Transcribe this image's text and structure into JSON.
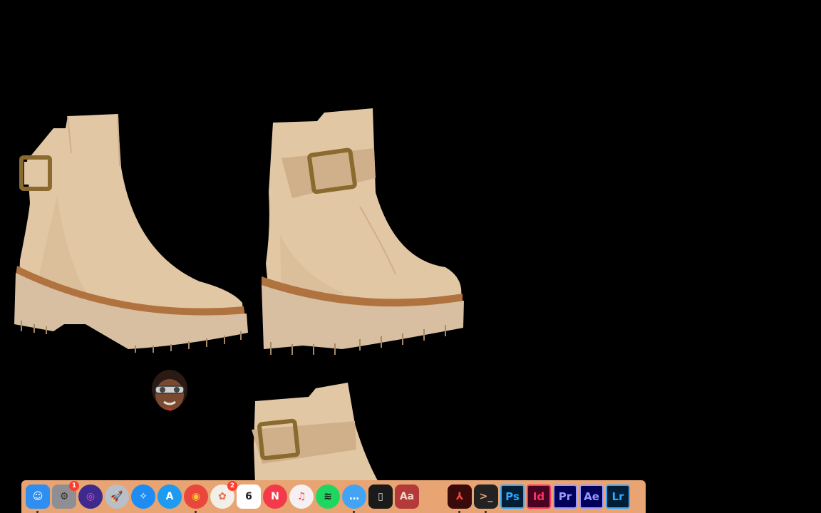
{
  "dock": {
    "items": [
      {
        "name": "finder-icon",
        "glyph": "☺",
        "bg": "#2e8ff0",
        "fg": "#ffffff",
        "running": true
      },
      {
        "name": "system-preferences-icon",
        "glyph": "⚙",
        "bg": "#8e8e93",
        "fg": "#333333",
        "badge": "1",
        "running": false
      },
      {
        "name": "siri-icon",
        "glyph": "◎",
        "bg": "#3d2a8c",
        "fg": "#e04dd0",
        "round": true,
        "running": false
      },
      {
        "name": "launchpad-icon",
        "glyph": "🚀",
        "bg": "#b9bec7",
        "fg": "#333333",
        "round": true,
        "running": false
      },
      {
        "name": "safari-icon",
        "glyph": "✧",
        "bg": "#1d8cf5",
        "fg": "#ffffff",
        "round": true,
        "running": false
      },
      {
        "name": "app-store-icon",
        "glyph": "A",
        "bg": "#1c9bf0",
        "fg": "#ffffff",
        "round": true,
        "running": false
      },
      {
        "name": "chrome-icon",
        "glyph": "◉",
        "bg": "#e9473b",
        "fg": "#f7c531",
        "round": true,
        "running": true
      },
      {
        "name": "photos-icon",
        "glyph": "✿",
        "bg": "#f2efe9",
        "fg": "#e86a4a",
        "badge": "2",
        "round": true,
        "running": false
      },
      {
        "name": "calendar-icon",
        "glyph": "6",
        "bg": "#ffffff",
        "fg": "#222222",
        "running": false
      },
      {
        "name": "news-icon",
        "glyph": "N",
        "bg": "#f23a4b",
        "fg": "#ffffff",
        "round": true,
        "running": false
      },
      {
        "name": "music-icon",
        "glyph": "♫",
        "bg": "#f6f0f2",
        "fg": "#f2465e",
        "round": true,
        "running": false
      },
      {
        "name": "spotify-icon",
        "glyph": "≋",
        "bg": "#1ed760",
        "fg": "#111111",
        "round": true,
        "running": false
      },
      {
        "name": "messages-icon",
        "glyph": "…",
        "bg": "#43a4f5",
        "fg": "#ffffff",
        "round": true,
        "running": true
      },
      {
        "name": "phone-icon",
        "glyph": "▯",
        "bg": "#1a1a1a",
        "fg": "#dddddd",
        "running": false
      },
      {
        "name": "dictionary-icon",
        "glyph": "Aa",
        "bg": "#b43a3a",
        "fg": "#f4d9c8",
        "running": false
      },
      {
        "name": "blank-app-icon",
        "glyph": "",
        "bg": "#e8a472",
        "fg": "#000000",
        "running": false
      },
      {
        "name": "acrobat-icon",
        "glyph": "⅄",
        "bg": "#3a0a0a",
        "fg": "#ff4a3a",
        "running": true
      },
      {
        "name": "terminal-icon",
        "glyph": ">_",
        "bg": "#222222",
        "fg": "#e8a472",
        "running": true
      },
      {
        "name": "photoshop-icon",
        "glyph": "Ps",
        "bg": "#001e36",
        "fg": "#31a8ff",
        "adobe": true,
        "running": false
      },
      {
        "name": "indesign-icon",
        "glyph": "Id",
        "bg": "#49021f",
        "fg": "#ff3366",
        "adobe": true,
        "running": false
      },
      {
        "name": "premiere-icon",
        "glyph": "Pr",
        "bg": "#00005b",
        "fg": "#9999ff",
        "adobe": true,
        "running": false
      },
      {
        "name": "after-effects-icon",
        "glyph": "Ae",
        "bg": "#00005b",
        "fg": "#9999ff",
        "adobe": true,
        "running": false
      },
      {
        "name": "lightroom-icon",
        "glyph": "Lr",
        "bg": "#001e36",
        "fg": "#31a8ff",
        "adobe": true,
        "running": false
      }
    ]
  },
  "colors": {
    "desktop_bg": "#000000",
    "dock_bg": "#e8a472",
    "suede": "#e2c7a4",
    "suede_shade": "#cfb08a",
    "sole": "#d9bfa2",
    "welt": "#b0733f",
    "buckle": "#8a6a2e"
  }
}
